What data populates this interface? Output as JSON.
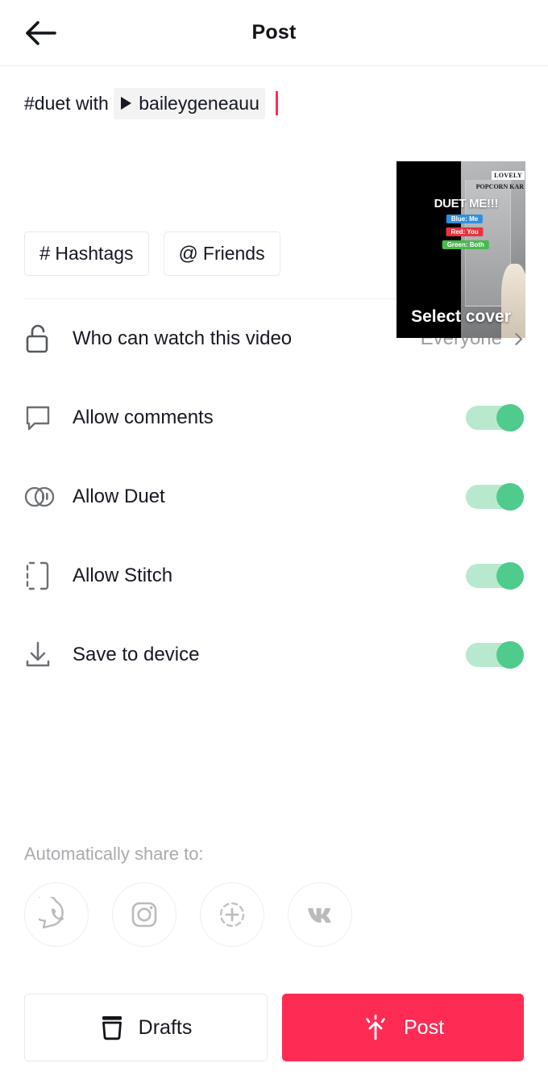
{
  "header": {
    "title": "Post",
    "back_icon": "arrow-left-icon"
  },
  "caption": {
    "prefix": "#duet with ",
    "mention": "baileygeneauu",
    "mention_icon": "play-triangle-icon",
    "caret_color": "#fe2c55"
  },
  "chips": [
    {
      "symbol": "#",
      "label": "Hashtags",
      "name": "hashtags-chip"
    },
    {
      "symbol": "@",
      "label": "Friends",
      "name": "friends-chip"
    }
  ],
  "cover": {
    "select_label": "Select cover",
    "overlay": {
      "poster_line1": "LOVELY",
      "poster_line2": "POPCORN KAR",
      "title": "DUET ME!!!",
      "tag_blue": "Blue: Me",
      "tag_red": "Red: You",
      "tag_green": "Green: Both"
    }
  },
  "settings": {
    "privacy": {
      "icon": "unlock-icon",
      "label": "Who can watch this video",
      "value": "Everyone"
    },
    "toggles": [
      {
        "icon": "comment-bubble-icon",
        "label": "Allow comments",
        "on": true,
        "name": "allow-comments"
      },
      {
        "icon": "duet-circles-icon",
        "label": "Allow Duet",
        "on": true,
        "name": "allow-duet"
      },
      {
        "icon": "stitch-bracket-icon",
        "label": "Allow Stitch",
        "on": true,
        "name": "allow-stitch"
      },
      {
        "icon": "download-icon",
        "label": "Save to device",
        "on": true,
        "name": "save-to-device"
      }
    ]
  },
  "share": {
    "label": "Automatically share to:",
    "icons": [
      {
        "name": "whatsapp-icon"
      },
      {
        "name": "instagram-icon"
      },
      {
        "name": "instagram-story-icon"
      },
      {
        "name": "vk-icon"
      }
    ]
  },
  "footer": {
    "drafts_label": "Drafts",
    "drafts_icon": "archive-box-icon",
    "post_label": "Post",
    "post_icon": "upload-burst-icon",
    "post_color": "#fe2c55"
  },
  "colors": {
    "toggle_on_knob": "#4ecb8d",
    "toggle_on_track": "#b8e9cf",
    "accent_red": "#fe2c55",
    "muted_text": "#9b9da1"
  }
}
